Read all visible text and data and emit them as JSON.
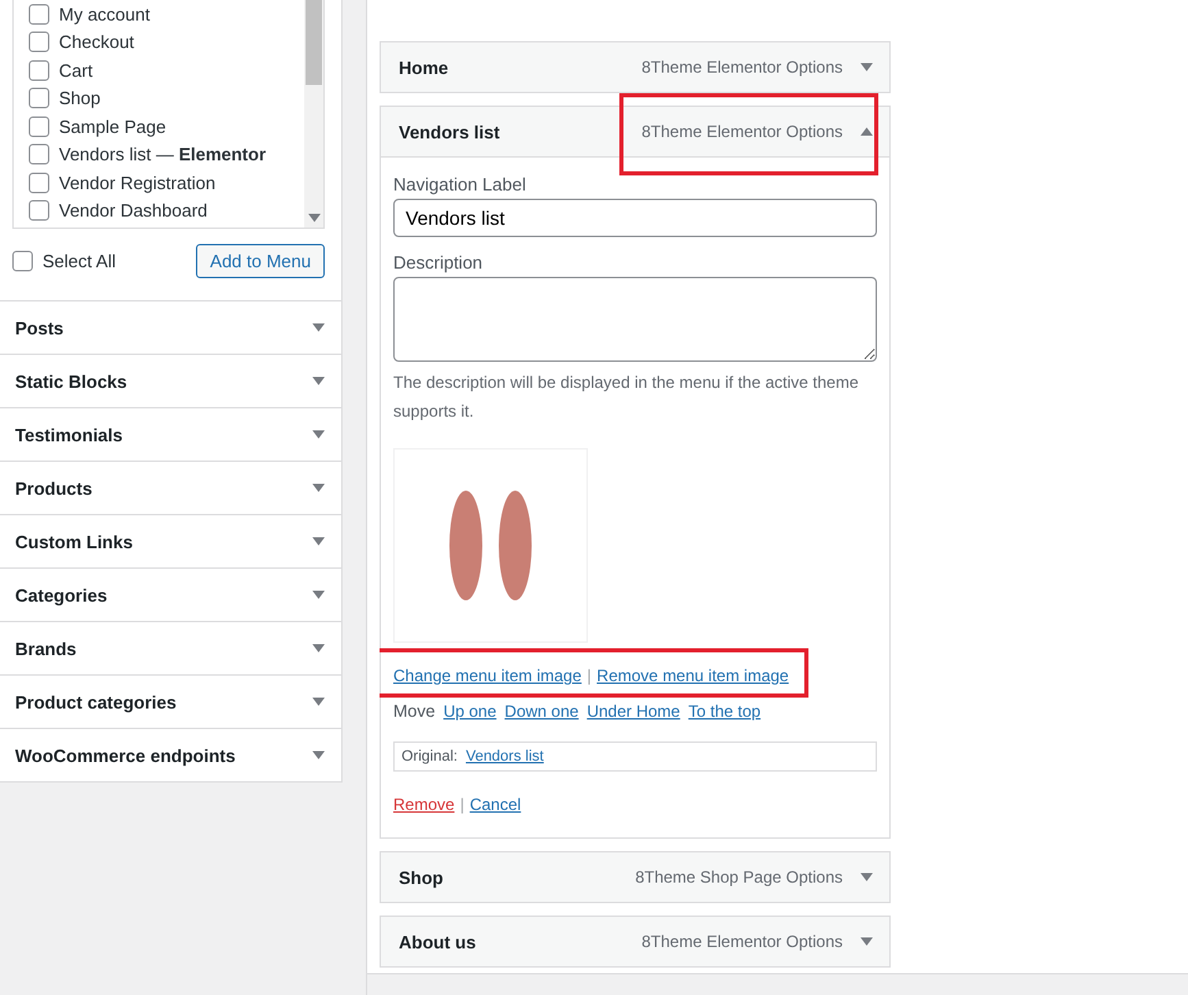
{
  "page_list": {
    "items": [
      {
        "label": "My account",
        "checked": false
      },
      {
        "label": "Checkout",
        "checked": false
      },
      {
        "label": "Cart",
        "checked": false
      },
      {
        "label": "Shop",
        "checked": false
      },
      {
        "label": "Sample Page",
        "checked": false
      },
      {
        "label": "Vendors list — **Elementor**",
        "checked": false
      },
      {
        "label": "Vendor Registration",
        "checked": false
      },
      {
        "label": "Vendor Dashboard",
        "checked": false
      }
    ]
  },
  "select_all": {
    "label": "Select All",
    "checked": false
  },
  "add_button": "Add to Menu",
  "sections": [
    {
      "label": "Posts",
      "expanded": false
    },
    {
      "label": "Static Blocks",
      "expanded": false
    },
    {
      "label": "Testimonials",
      "expanded": false
    },
    {
      "label": "Products",
      "expanded": false
    },
    {
      "label": "Custom Links",
      "expanded": false
    },
    {
      "label": "Categories",
      "expanded": false
    },
    {
      "label": "Brands",
      "expanded": false
    },
    {
      "label": "Product categories",
      "expanded": false
    },
    {
      "label": "WooCommerce endpoints",
      "expanded": false
    }
  ],
  "menu_items": [
    {
      "title": "Home",
      "type_label": "8Theme Elementor Options",
      "expanded": false,
      "highlighted": false
    },
    {
      "title": "Vendors list",
      "type_label": "8Theme Elementor Options",
      "expanded": true,
      "highlighted": true,
      "settings": {
        "nav_label_caption": "Navigation Label",
        "nav_label_value": "Vendors list",
        "description_caption": "Description",
        "description_hint": "The description will be displayed in the menu if the active theme supports it.",
        "image_links": {
          "change": "Change menu item image",
          "separator": "|",
          "remove": "Remove menu item image",
          "highlighted": true
        },
        "move_caption": "Move",
        "move_links": [
          "Up one",
          "Down one",
          "Under Home",
          "To the top"
        ],
        "original_caption": "Original:",
        "original_link": "Vendors list",
        "remove_link": "Remove",
        "action_separator": "|",
        "cancel_link": "Cancel"
      }
    },
    {
      "title": "Shop",
      "type_label": "8Theme Shop Page Options",
      "expanded": false,
      "highlighted": false
    },
    {
      "title": "About us",
      "type_label": "8Theme Elementor Options",
      "expanded": false,
      "highlighted": false
    }
  ]
}
